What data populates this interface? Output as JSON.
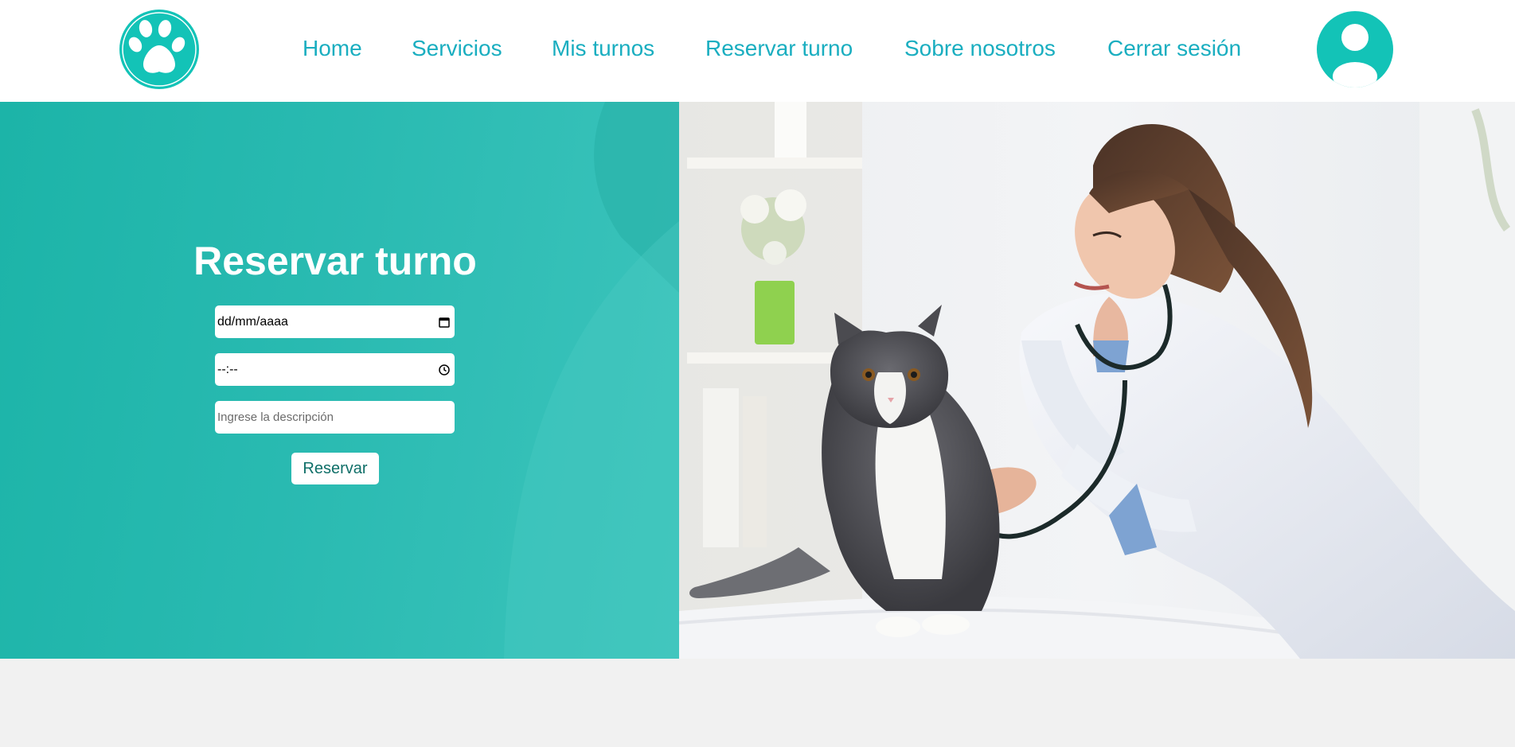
{
  "header": {
    "logo_icon": "paw-print-icon",
    "nav": [
      {
        "label": "Home"
      },
      {
        "label": "Servicios"
      },
      {
        "label": "Mis turnos"
      },
      {
        "label": "Reservar turno"
      },
      {
        "label": "Sobre nosotros"
      },
      {
        "label": "Cerrar sesión"
      }
    ],
    "profile_icon": "user-avatar-icon"
  },
  "form": {
    "title": "Reservar turno",
    "date_value": "dd/mm/aaaa",
    "time_value": "--:--",
    "description_placeholder": "Ingrese la descripción",
    "submit_label": "Reservar"
  },
  "colors": {
    "accent": "#1aaec0",
    "brand_teal": "#13c3b7",
    "panel_teal": "#29b9b0"
  },
  "hero_image": {
    "subject": "veterinarian-examining-cat-photo"
  }
}
